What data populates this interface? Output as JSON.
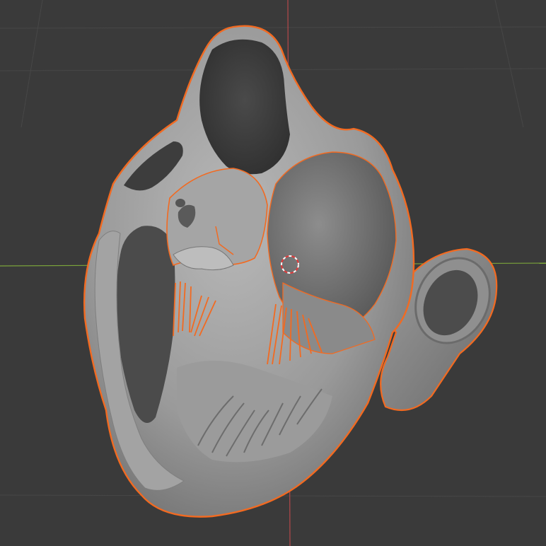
{
  "viewport": {
    "background": "#3a3a3a",
    "grid_color": "#4a4a4a",
    "x_axis_color": "#7ba43a",
    "y_axis_color": "#b5484a",
    "selection_outline_color": "#f26a21",
    "mesh_color": "#a9a9a9",
    "mesh_shadow_color": "#5f5f5f"
  },
  "scene": {
    "selected_object": "heart-cross-section-mesh",
    "objects": [
      "heart-cross-section-mesh",
      "aorta-tube-mesh"
    ],
    "cursor": "3d-cursor"
  }
}
